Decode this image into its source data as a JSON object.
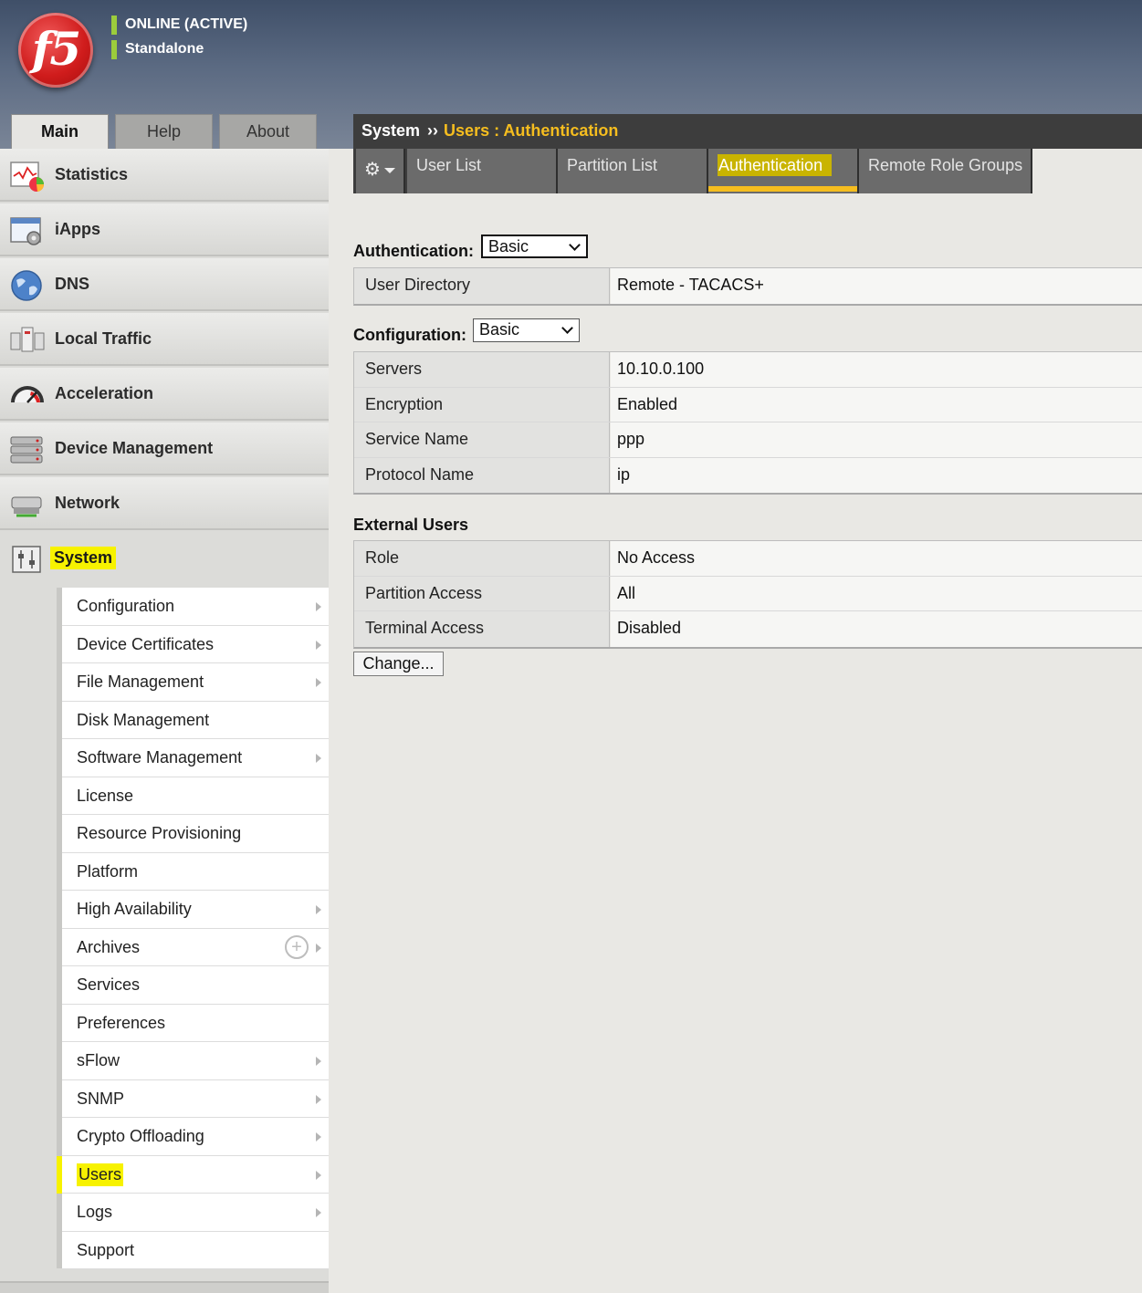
{
  "header": {
    "logo_text": "f5",
    "status_line1": "ONLINE (ACTIVE)",
    "status_line2": "Standalone"
  },
  "top_tabs": [
    {
      "label": "Main",
      "active": true
    },
    {
      "label": "Help",
      "active": false
    },
    {
      "label": "About",
      "active": false
    }
  ],
  "breadcrumb": {
    "root": "System",
    "separator": "››",
    "current": "Users : Authentication"
  },
  "sidebar": {
    "items": [
      {
        "label": "Statistics",
        "icon": "statistics-icon"
      },
      {
        "label": "iApps",
        "icon": "iapps-icon"
      },
      {
        "label": "DNS",
        "icon": "dns-globe-icon"
      },
      {
        "label": "Local Traffic",
        "icon": "local-traffic-icon"
      },
      {
        "label": "Acceleration",
        "icon": "gauge-icon"
      },
      {
        "label": "Device Management",
        "icon": "server-stack-icon"
      },
      {
        "label": "Network",
        "icon": "network-switch-icon"
      },
      {
        "label": "System",
        "icon": "system-sliders-icon"
      }
    ],
    "submenu": [
      {
        "label": "Configuration",
        "arrow": true
      },
      {
        "label": "Device Certificates",
        "arrow": true
      },
      {
        "label": "File Management",
        "arrow": true
      },
      {
        "label": "Disk Management",
        "arrow": false
      },
      {
        "label": "Software Management",
        "arrow": true
      },
      {
        "label": "License",
        "arrow": false
      },
      {
        "label": "Resource Provisioning",
        "arrow": false
      },
      {
        "label": "Platform",
        "arrow": false
      },
      {
        "label": "High Availability",
        "arrow": true
      },
      {
        "label": "Archives",
        "arrow": true,
        "plus": "+"
      },
      {
        "label": "Services",
        "arrow": false
      },
      {
        "label": "Preferences",
        "arrow": false
      },
      {
        "label": "sFlow",
        "arrow": true
      },
      {
        "label": "SNMP",
        "arrow": true
      },
      {
        "label": "Crypto Offloading",
        "arrow": true
      },
      {
        "label": "Users",
        "arrow": true,
        "highlight": true
      },
      {
        "label": "Logs",
        "arrow": true
      },
      {
        "label": "Support",
        "arrow": false
      }
    ]
  },
  "subtabs": [
    {
      "label": "User List"
    },
    {
      "label": "Partition List"
    },
    {
      "label": "Authentication",
      "active": true
    },
    {
      "label": "Remote Role Groups"
    }
  ],
  "authentication": {
    "label": "Authentication:",
    "select_value": "Basic",
    "rows": [
      {
        "key": "User Directory",
        "value": "Remote - TACACS+"
      }
    ]
  },
  "configuration": {
    "label": "Configuration:",
    "select_value": "Basic",
    "rows": [
      {
        "key": "Servers",
        "value": "10.10.0.100"
      },
      {
        "key": "Encryption",
        "value": "Enabled"
      },
      {
        "key": "Service Name",
        "value": "ppp"
      },
      {
        "key": "Protocol Name",
        "value": "ip"
      }
    ]
  },
  "external_users": {
    "label": "External Users",
    "rows": [
      {
        "key": "Role",
        "value": "No Access"
      },
      {
        "key": "Partition Access",
        "value": "All"
      },
      {
        "key": "Terminal Access",
        "value": "Disabled"
      }
    ]
  },
  "change_button": "Change...",
  "colors": {
    "highlight_yellow": "#f7f200",
    "breadcrumb_accent": "#f5bd1f",
    "status_green": "#9ccc3c",
    "logo_red": "#d01c1c"
  }
}
